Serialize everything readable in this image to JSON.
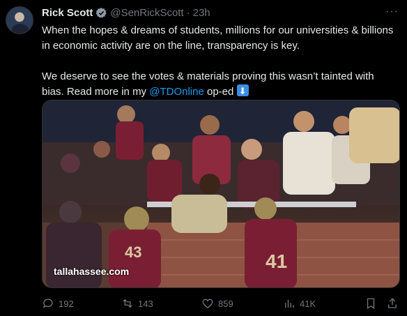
{
  "author": {
    "name": "Rick Scott",
    "handle": "@SenRickScott",
    "time": "23h"
  },
  "tweet": {
    "para1": "When the hopes & dreams of students, millions for our universities & billions in economic activity are on the line, transparency is key.",
    "para2_prefix": "We deserve to see the votes & materials proving this wasn’t tainted with bias. Read more in my ",
    "mention": "@TDOnline",
    "para2_suffix": " op-ed"
  },
  "media": {
    "watermark": "tallahassee.com"
  },
  "actions": {
    "replies": "192",
    "reposts": "143",
    "likes": "859",
    "views": "41K"
  },
  "icons": [
    "verified-badge-icon",
    "more-icon",
    "down-arrow-emoji-icon",
    "reply-icon",
    "repost-icon",
    "like-icon",
    "views-icon",
    "bookmark-icon",
    "share-icon"
  ],
  "colors": {
    "background": "#000000",
    "text": "#e7e9ea",
    "secondary": "#71767b",
    "link": "#1d9bf0"
  }
}
